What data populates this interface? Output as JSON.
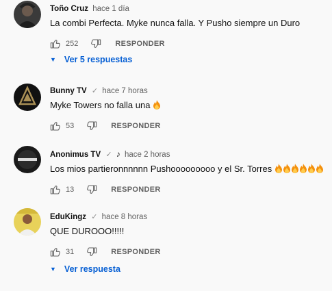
{
  "comments": [
    {
      "author": "Toño Cruz",
      "time": "hace 1 día",
      "text": "La combi Perfecta. Myke nunca falla. Y Pusho siempre un Duro",
      "likes": "252",
      "reply_label": "RESPONDER",
      "replies_label": "Ver 5 respuestas"
    },
    {
      "author": "Bunny TV",
      "verified": "✓",
      "time": "hace 7 horas",
      "text": "Myke Towers no falla una",
      "likes": "53",
      "reply_label": "RESPONDER"
    },
    {
      "author": "Anonimus TV",
      "verified": "✓",
      "note": "♪",
      "time": "hace 2 horas",
      "text": "Los mios partieronnnnnn Pushooooooooo y el Sr. Torres",
      "likes": "13",
      "reply_label": "RESPONDER"
    },
    {
      "author": "EduKingz",
      "verified": "✓",
      "time": "hace 8 horas",
      "text": "QUE DUROOO!!!!!",
      "likes": "31",
      "reply_label": "RESPONDER",
      "replies_label": "Ver respuesta"
    }
  ],
  "colors": {
    "link": "#065fd4",
    "muted": "#606060",
    "fire": "#f4900c"
  },
  "icons": {
    "like": "thumbs-up-icon",
    "dislike": "thumbs-down-icon",
    "expand": "chevron-down-icon",
    "emoji": "fire-emoji"
  }
}
